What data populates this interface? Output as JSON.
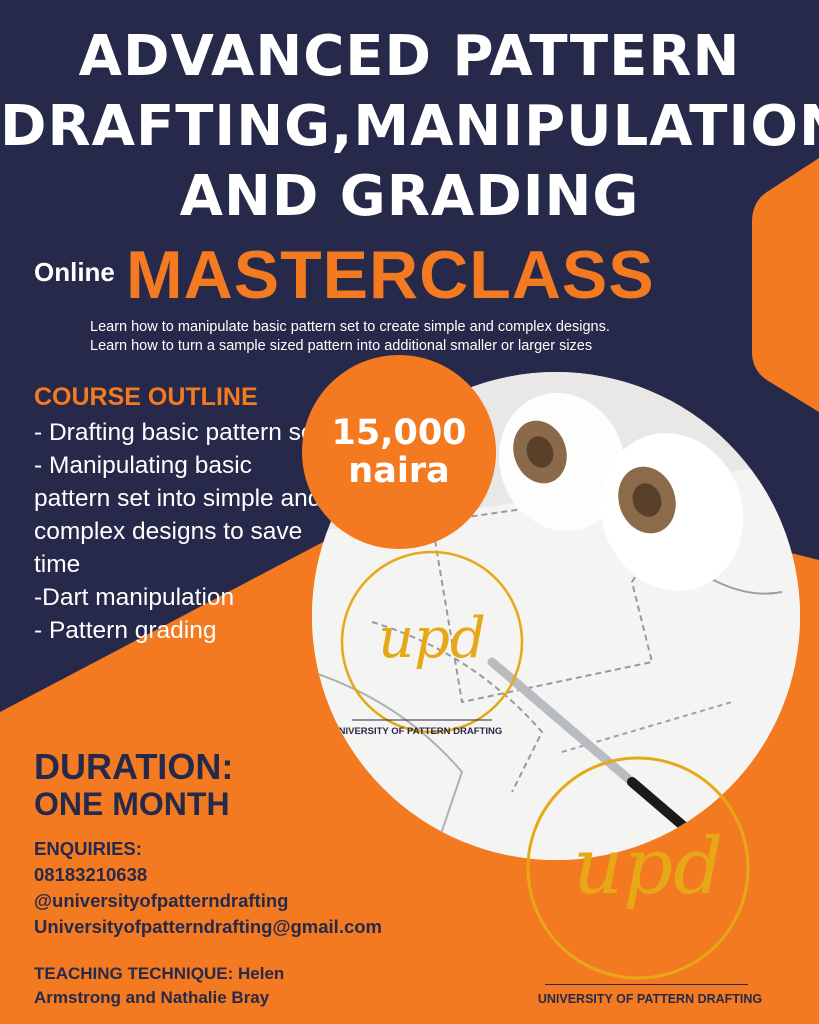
{
  "title": {
    "line1": "ADVANCED PATTERN",
    "line2": "DRAFTING,MANIPULATION",
    "line3": "AND GRADING"
  },
  "subtitle": {
    "online": "Online",
    "masterclass": "MASTERCLASS"
  },
  "learn": {
    "line1": "Learn how to manipulate basic pattern set to create simple and complex designs.",
    "line2": "Learn how to turn a sample sized pattern into additional smaller or larger sizes"
  },
  "course_outline": {
    "heading": "COURSE OUTLINE",
    "items": [
      "- Drafting basic pattern set",
      "- Manipulating basic pattern set into simple and complex designs to save time",
      "-Dart manipulation",
      "- Pattern grading"
    ]
  },
  "price": {
    "amount": "15,000",
    "unit": "naira"
  },
  "duration": {
    "heading": "DURATION:",
    "value": "ONE MONTH"
  },
  "enquiries": {
    "heading": "ENQUIRIES:",
    "phone": "08183210638",
    "handle": "@universityofpatterndrafting",
    "email": "Universityofpatterndrafting@gmail.com"
  },
  "teaching": {
    "text": "TEACHING TECHNIQUE: Helen Armstrong and Nathalie Bray"
  },
  "logo": {
    "mark": "upd",
    "caption_small": "UNIVERSITY OF PATTERN DRAFTING",
    "caption": "UNIVERSITY OF PATTERN DRAFTING"
  },
  "colors": {
    "navy": "#26294a",
    "orange": "#f47a21",
    "gold": "#e6a817",
    "white": "#ffffff"
  }
}
